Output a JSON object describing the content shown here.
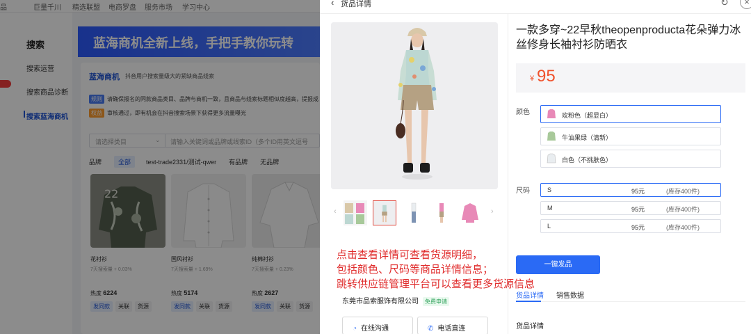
{
  "topnav": {
    "items": [
      "巨量千川",
      "精选联盟",
      "电商罗盘",
      "服务市场",
      "学习中心"
    ]
  },
  "leftnav": {
    "title": "搜索",
    "items": [
      "搜索运营",
      "搜索商品诊断",
      "搜索蓝海商机"
    ],
    "badge": "热卖"
  },
  "banner": {
    "text": "蓝海商机全新上线，手把手教你玩转"
  },
  "panel": {
    "title": "蓝海商机",
    "desc": "抖音用户搜索量级大的紧缺商品线索",
    "rule1_tag": "规则",
    "rule1": "请确保报名的同款商品类目、品牌与商机一致，且商品与线索标题相似度越高，提报成",
    "rule2_tag": "权益",
    "rule2": "审核通过，即有机会在抖音搜索场景下获得更多流量曝光",
    "category_placeholder": "请选择类目",
    "keyword_placeholder": "请输入关键词或品牌或线索ID（多个ID用英文逗号",
    "brand_label": "品牌",
    "brand_chips": [
      "全部",
      "test-trade2331/测试-qwer",
      "有品牌",
      "无品牌"
    ]
  },
  "products": [
    {
      "name": "花衬衫",
      "sub": "7天搜索量 + 0.03%",
      "heat_label": "热度",
      "heat": "6224",
      "btns": [
        "发同款",
        "关联",
        "货源"
      ]
    },
    {
      "name": "国风衬衫",
      "sub": "7天搜索量 + 1.69%",
      "heat_label": "热度",
      "heat": "5174",
      "btns": [
        "发同款",
        "关联",
        "货源"
      ]
    },
    {
      "name": "纯棉衬衫",
      "sub": "7天搜索量 + 0.23%",
      "heat_label": "热度",
      "heat": "2627",
      "btns": [
        "发同款",
        "关联",
        "货源"
      ]
    }
  ],
  "drawer": {
    "title": "货品详情",
    "product_title": "一款多穿~22早秋theopenproducta花朵弹力冰丝修身长袖衬衫防晒衣",
    "currency": "¥",
    "price": "95",
    "color_label": "颜色",
    "colors": [
      {
        "name": "玫粉色（超显白）",
        "swatch": "#e889b7"
      },
      {
        "name": "牛油果绿（清新）",
        "swatch": "#a8c99a"
      },
      {
        "name": "白色（不挑肤色）",
        "swatch": "#e9edf0"
      }
    ],
    "size_label": "尺码",
    "sizes": [
      {
        "size": "S",
        "price": "95元",
        "stock": "(库存400件)"
      },
      {
        "size": "M",
        "price": "95元",
        "stock": "(库存400件)"
      },
      {
        "size": "L",
        "price": "95元",
        "stock": "(库存400件)"
      }
    ],
    "buy_button": "一键发品",
    "tabs": [
      "货品详情",
      "销售数据"
    ],
    "section_title": "货品详情",
    "annotation": [
      "点击查看详情可查看货源明细，",
      "包括颜色、尺码等商品详情信息；",
      "跳转供应链管理平台可以查看更多货源信息"
    ],
    "supplier": "东莞市品索服饰有限公司",
    "supplier_tag": "免费申请",
    "contact_online": "在线沟通",
    "contact_phone": "电话直连"
  },
  "colors": {
    "accent": "#2a6af5",
    "price": "#f0522c",
    "annotation": "#e02d2d"
  }
}
